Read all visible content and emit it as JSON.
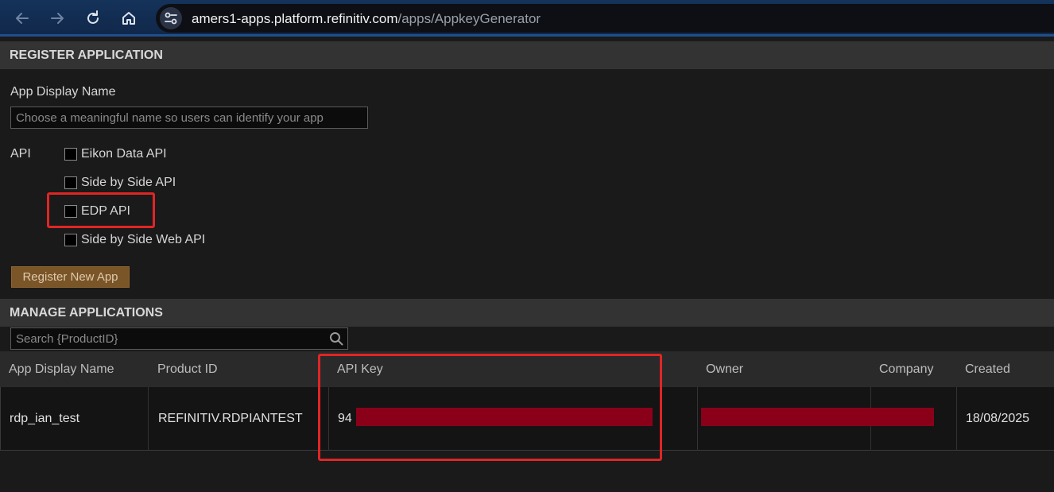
{
  "browser": {
    "url_host": "amers1-apps.platform.refinitiv.com",
    "url_path": "/apps/AppkeyGenerator"
  },
  "register": {
    "header": "REGISTER APPLICATION",
    "name_label": "App Display Name",
    "name_placeholder": "Choose a meaningful name so users can identify your app",
    "api_label": "API",
    "api_options": [
      {
        "label": "Eikon Data API",
        "checked": false
      },
      {
        "label": "Side by Side API",
        "checked": false
      },
      {
        "label": "EDP API",
        "checked": false
      },
      {
        "label": "Side by Side Web API",
        "checked": false
      }
    ],
    "register_button": "Register New App"
  },
  "manage": {
    "header": "MANAGE APPLICATIONS",
    "search_placeholder": "Search {ProductID}",
    "columns": [
      "App Display Name",
      "Product ID",
      "API Key",
      "Owner",
      "Company",
      "Created"
    ],
    "rows": [
      {
        "app_name": "rdp_ian_test",
        "product_id": "REFINITIV.RDPIANTEST",
        "api_key_visible": "94",
        "created": "18/08/2025"
      }
    ]
  },
  "colors": {
    "highlight": "#e02525",
    "redaction": "#8b0019",
    "button": "#7a5527"
  }
}
